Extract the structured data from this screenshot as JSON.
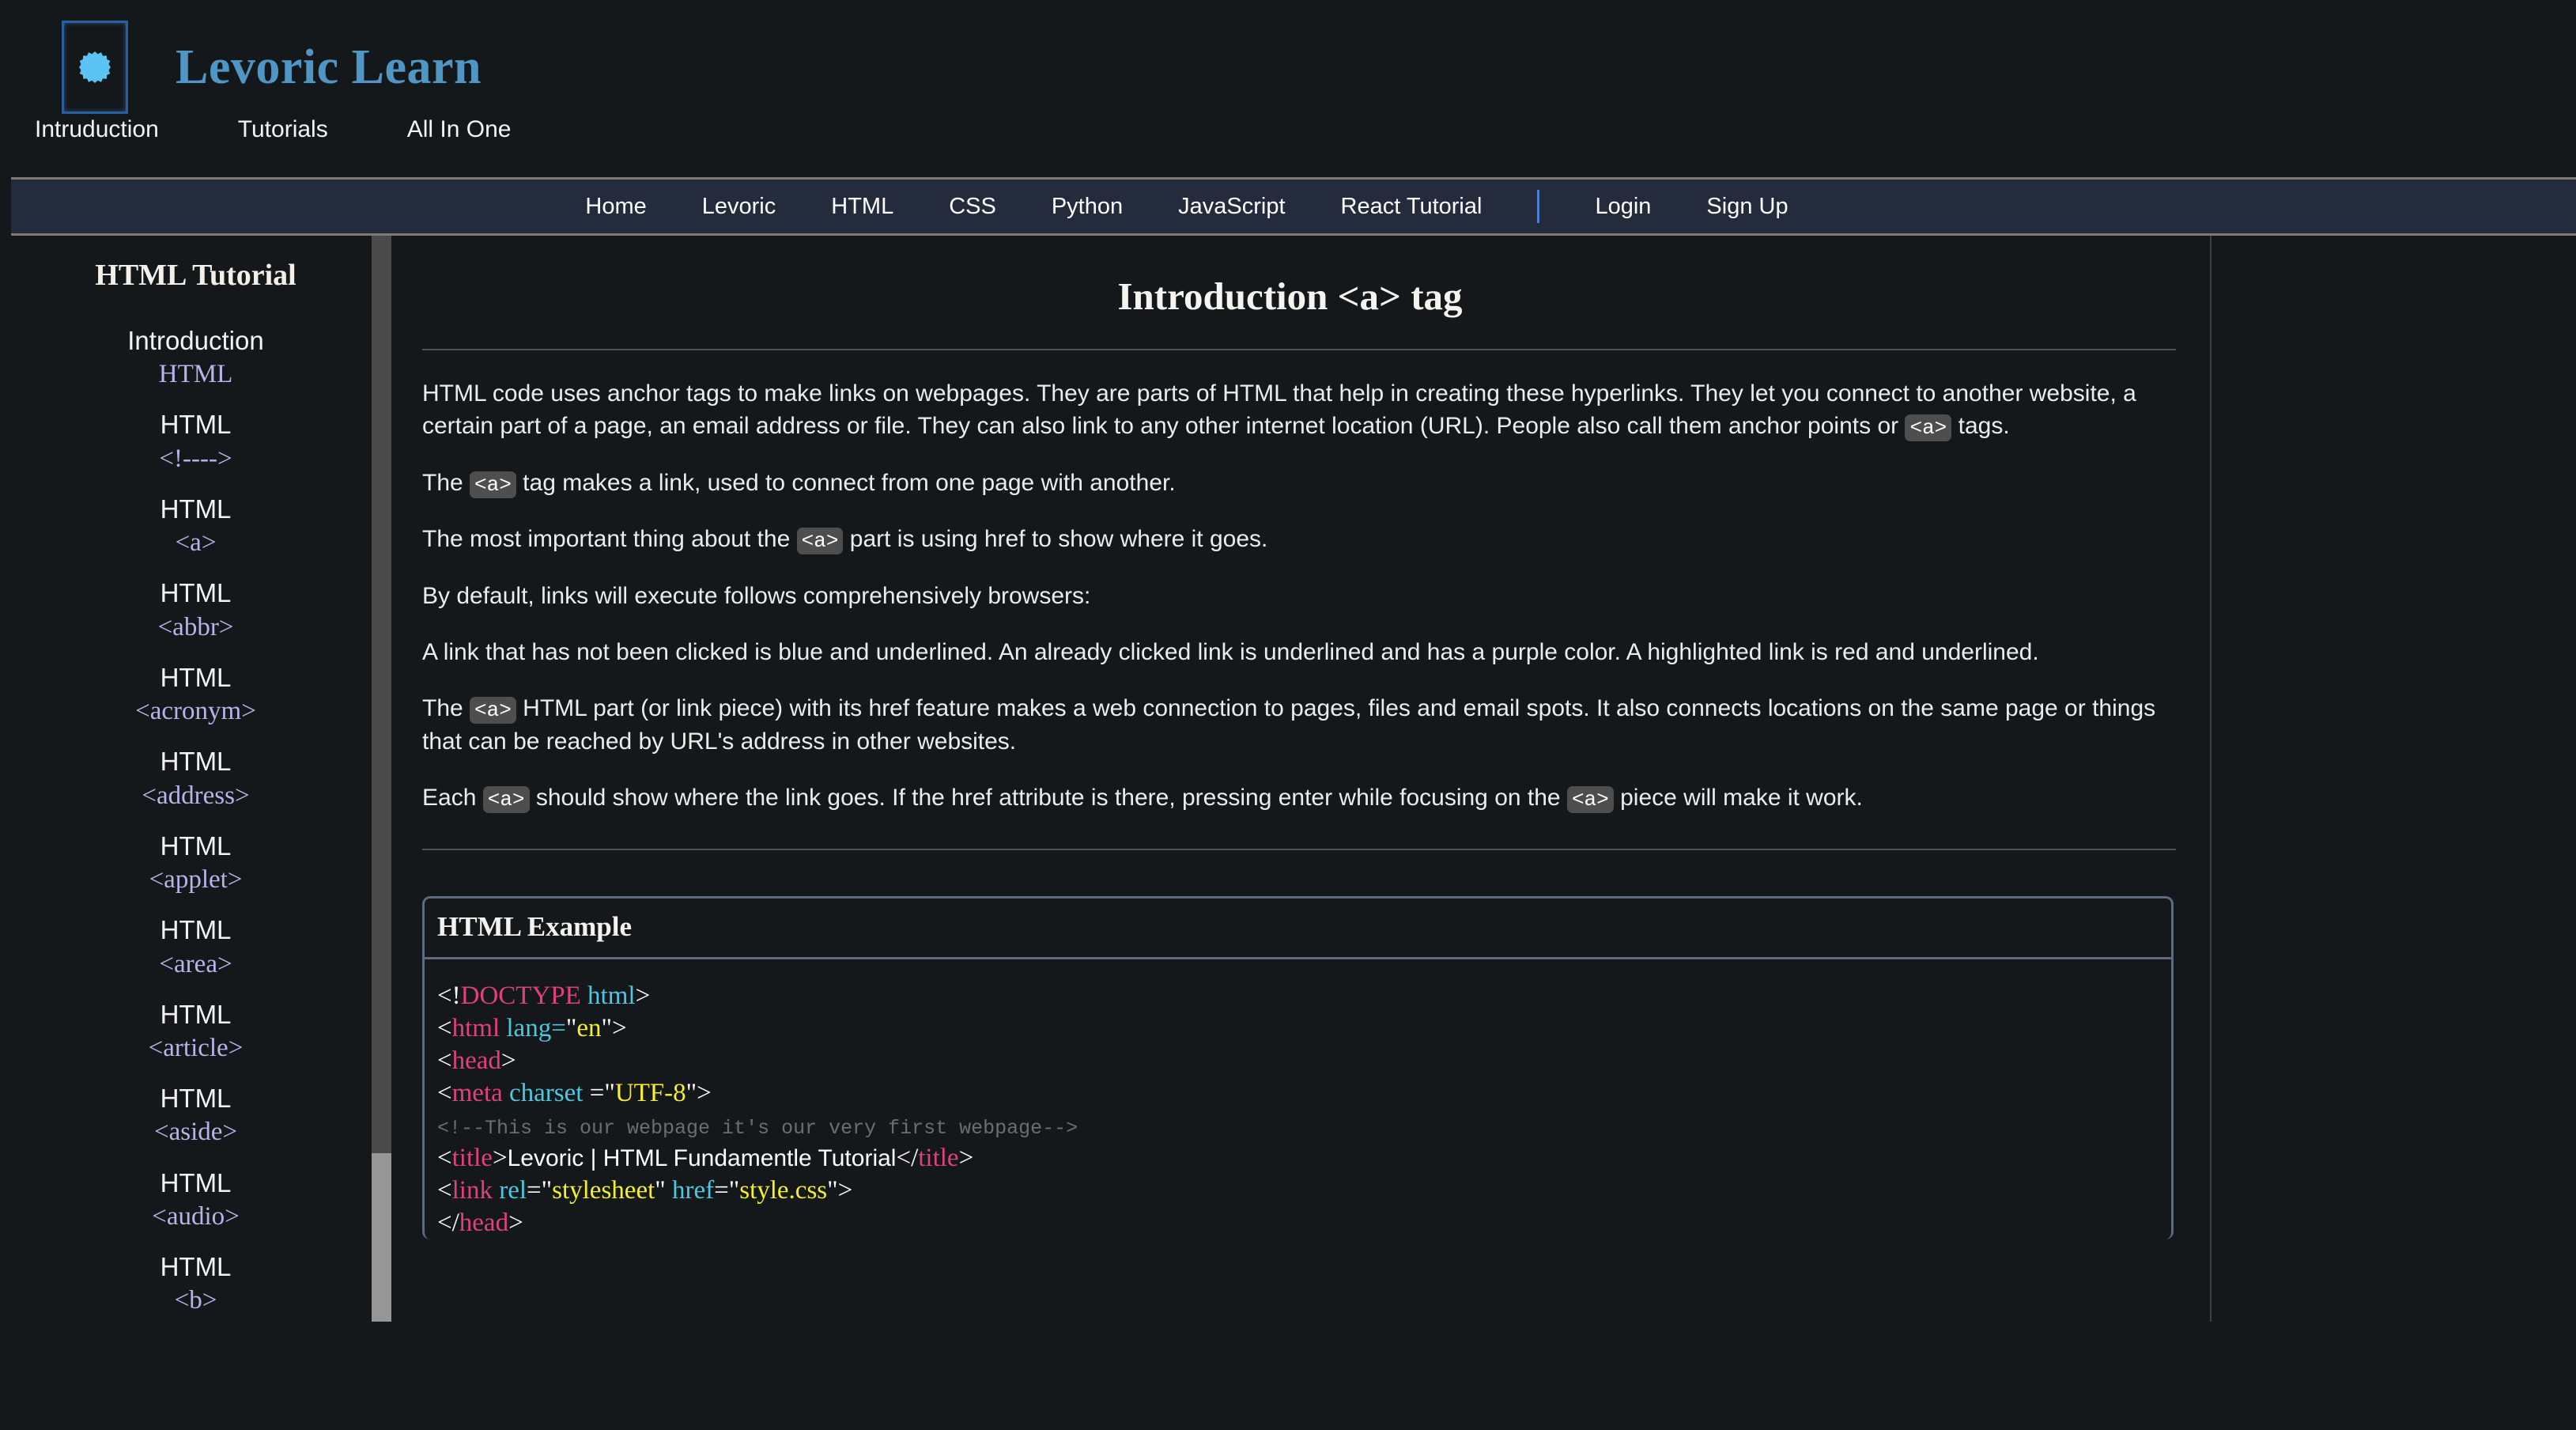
{
  "brand": {
    "logo_icon": "starburst-icon",
    "title": "Levoric Learn"
  },
  "subnav": {
    "items": [
      {
        "label": "Intruduction"
      },
      {
        "label": "Tutorials"
      },
      {
        "label": "All In One"
      }
    ]
  },
  "mainnav": {
    "items": [
      {
        "label": "Home"
      },
      {
        "label": "Levoric"
      },
      {
        "label": "HTML"
      },
      {
        "label": "CSS"
      },
      {
        "label": "Python"
      },
      {
        "label": "JavaScript"
      },
      {
        "label": "React Tutorial"
      }
    ],
    "auth": [
      {
        "label": "Login"
      },
      {
        "label": "Sign Up"
      }
    ]
  },
  "sidebar": {
    "title": "HTML Tutorial",
    "items": [
      {
        "label": "Introduction",
        "tag": "HTML"
      },
      {
        "label": "HTML",
        "tag": "<!---->"
      },
      {
        "label": "HTML",
        "tag": "<a>"
      },
      {
        "label": "HTML",
        "tag": "<abbr>"
      },
      {
        "label": "HTML",
        "tag": "<acronym>"
      },
      {
        "label": "HTML",
        "tag": "<address>"
      },
      {
        "label": "HTML",
        "tag": "<applet>"
      },
      {
        "label": "HTML",
        "tag": "<area>"
      },
      {
        "label": "HTML",
        "tag": "<article>"
      },
      {
        "label": "HTML",
        "tag": "<aside>"
      },
      {
        "label": "HTML",
        "tag": "<audio>"
      },
      {
        "label": "HTML",
        "tag": "<b>"
      }
    ]
  },
  "content": {
    "title": "Introduction <a> tag",
    "paragraphs": [
      {
        "parts": [
          {
            "t": "text",
            "v": "HTML code uses anchor tags to make links on webpages. They are parts of HTML that help in creating these hyperlinks. They let you connect to another website, a certain part of a page, an email address or file. They can also link to any other internet location (URL). People also call them anchor points or "
          },
          {
            "t": "code",
            "v": "<a>"
          },
          {
            "t": "text",
            "v": " tags."
          }
        ]
      },
      {
        "parts": [
          {
            "t": "text",
            "v": "The "
          },
          {
            "t": "code",
            "v": "<a>"
          },
          {
            "t": "text",
            "v": " tag makes a link, used to connect from one page with another."
          }
        ]
      },
      {
        "parts": [
          {
            "t": "text",
            "v": "The most important thing about the "
          },
          {
            "t": "code",
            "v": "<a>"
          },
          {
            "t": "text",
            "v": " part is using href to show where it goes."
          }
        ]
      },
      {
        "parts": [
          {
            "t": "text",
            "v": "By default, links will execute follows comprehensively browsers:"
          }
        ]
      },
      {
        "parts": [
          {
            "t": "text",
            "v": "A link that has not been clicked is blue and underlined. An already clicked link is underlined and has a purple color. A highlighted link is red and underlined."
          }
        ]
      },
      {
        "parts": [
          {
            "t": "text",
            "v": "The "
          },
          {
            "t": "code",
            "v": "<a>"
          },
          {
            "t": "text",
            "v": " HTML part (or link piece) with its href feature makes a web connection to pages, files and email spots. It also connects locations on the same page or things that can be reached by URL's address in other websites."
          }
        ]
      },
      {
        "parts": [
          {
            "t": "text",
            "v": "Each "
          },
          {
            "t": "code",
            "v": "<a>"
          },
          {
            "t": "text",
            "v": " should show where the link goes. If the href attribute is there, pressing enter while focusing on the "
          },
          {
            "t": "code",
            "v": "<a>"
          },
          {
            "t": "text",
            "v": " piece will make it work."
          }
        ]
      }
    ],
    "example": {
      "heading": "HTML Example",
      "lines": [
        [
          {
            "c": "punct",
            "v": "<!"
          },
          {
            "c": "doctype",
            "v": "DOCTYPE "
          },
          {
            "c": "doctype-val",
            "v": "html"
          },
          {
            "c": "punct",
            "v": ">"
          }
        ],
        [
          {
            "c": "punct",
            "v": "<"
          },
          {
            "c": "tag",
            "v": "html "
          },
          {
            "c": "attr",
            "v": "lang="
          },
          {
            "c": "punct",
            "v": "\""
          },
          {
            "c": "val",
            "v": "en"
          },
          {
            "c": "punct",
            "v": "\">"
          }
        ],
        [
          {
            "c": "punct",
            "v": "<"
          },
          {
            "c": "tag",
            "v": "head"
          },
          {
            "c": "punct",
            "v": ">"
          }
        ],
        [
          {
            "c": "punct",
            "v": "<"
          },
          {
            "c": "tag",
            "v": "meta "
          },
          {
            "c": "attr",
            "v": "charset "
          },
          {
            "c": "punct",
            "v": "=\""
          },
          {
            "c": "val",
            "v": "UTF-8"
          },
          {
            "c": "punct",
            "v": "\">"
          }
        ],
        [
          {
            "c": "comment",
            "v": "<!--This is our webpage it's our very first webpage-->"
          }
        ],
        [
          {
            "c": "punct",
            "v": "<"
          },
          {
            "c": "tag",
            "v": "title"
          },
          {
            "c": "punct",
            "v": ">"
          },
          {
            "c": "txt",
            "v": "Levoric | HTML Fundamentle Tutorial"
          },
          {
            "c": "punct",
            "v": "</"
          },
          {
            "c": "tag",
            "v": "title"
          },
          {
            "c": "punct",
            "v": ">"
          }
        ],
        [
          {
            "c": "punct",
            "v": "<"
          },
          {
            "c": "tag",
            "v": "link "
          },
          {
            "c": "attr",
            "v": "rel"
          },
          {
            "c": "punct",
            "v": "=\""
          },
          {
            "c": "val",
            "v": "stylesheet"
          },
          {
            "c": "punct",
            "v": "\" "
          },
          {
            "c": "attr",
            "v": "href"
          },
          {
            "c": "punct",
            "v": "=\""
          },
          {
            "c": "val",
            "v": "style.css"
          },
          {
            "c": "punct",
            "v": "\">"
          }
        ],
        [
          {
            "c": "punct",
            "v": "</"
          },
          {
            "c": "tag",
            "v": "head"
          },
          {
            "c": "punct",
            "v": ">"
          }
        ]
      ]
    }
  },
  "colors": {
    "page_bg": "#14181b",
    "nav_bg": "#242b3d",
    "brand": "#4f96c4",
    "tag_pink": "#e0407c",
    "attr_cyan": "#4ec8e0",
    "value_yellow": "#f6ef2a",
    "comment_grey": "#6d6d6d",
    "sidebar_tag": "#b7b4e8",
    "nav_separator": "#4d7fd0"
  }
}
